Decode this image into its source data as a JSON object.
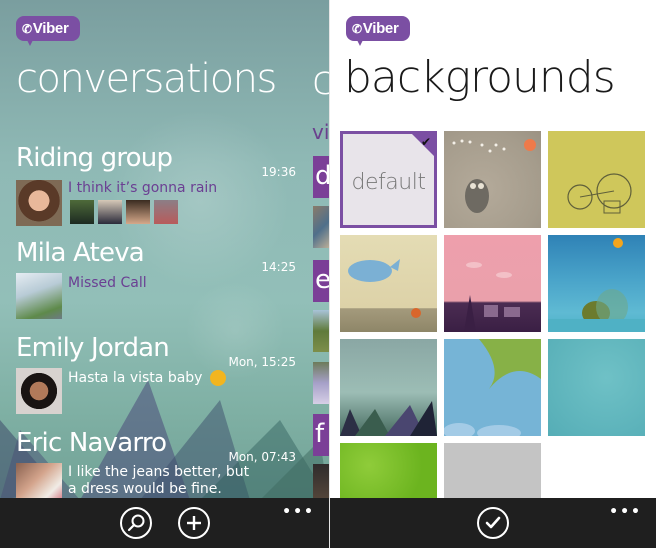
{
  "app": {
    "brand": "Viber"
  },
  "colors": {
    "accent": "#7b4fa3",
    "message_purple": "#6b3f93",
    "appbar": "#1f1f1f"
  },
  "conversations_screen": {
    "title": "conversations",
    "peek": {
      "title_fragment": "c",
      "subtitle_fragment": "vi",
      "tile_letters": [
        "d",
        "e",
        "f"
      ]
    },
    "items": [
      {
        "name": "Riding group",
        "time": "19:36",
        "message": "I think it’s gonna rain",
        "message_style": "purple",
        "participants_shown": 4
      },
      {
        "name": "Mila Ateva",
        "time": "14:25",
        "message": "Missed Call",
        "message_style": "purple"
      },
      {
        "name": "Emily Jordan",
        "time": "Mon, 15:25",
        "message": "Hasta la vista baby",
        "emoji": "winking-face",
        "message_style": "white"
      },
      {
        "name": "Eric Navarro",
        "time": "Mon, 07:43",
        "message_line1": "I like the jeans better, but",
        "message_line2": "a dress would be fine.",
        "message_style": "white"
      }
    ],
    "appbar": {
      "buttons": [
        "search",
        "new-conversation"
      ],
      "more": "•••"
    }
  },
  "backgrounds_screen": {
    "title": "backgrounds",
    "tiles": [
      {
        "id": "default",
        "label": "default",
        "selected": true
      },
      {
        "id": "owl",
        "label": ""
      },
      {
        "id": "bicycle",
        "label": ""
      },
      {
        "id": "whale",
        "label": ""
      },
      {
        "id": "pink-town",
        "label": ""
      },
      {
        "id": "island-sea",
        "label": ""
      },
      {
        "id": "misty-mountains",
        "label": ""
      },
      {
        "id": "palm-sky",
        "label": ""
      },
      {
        "id": "teal-texture",
        "label": ""
      },
      {
        "id": "green-bokeh",
        "label": ""
      },
      {
        "id": "gray",
        "label": ""
      }
    ],
    "appbar": {
      "buttons": [
        "confirm"
      ],
      "more": "•••"
    }
  }
}
